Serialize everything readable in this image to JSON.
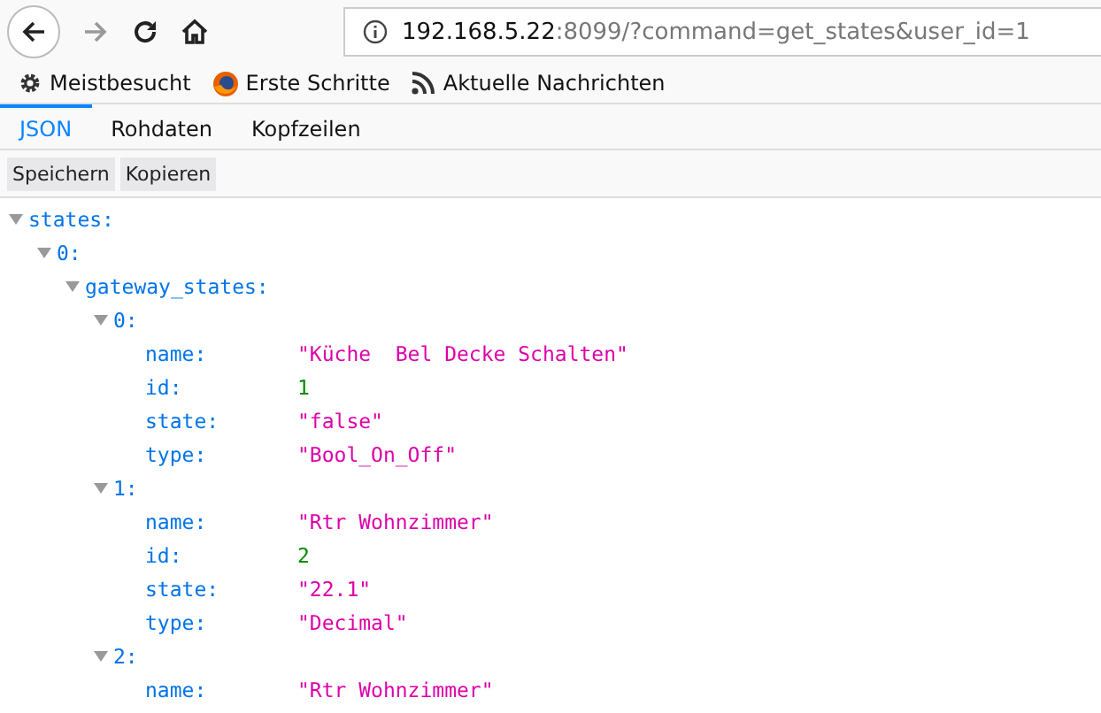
{
  "address_bar": {
    "host": "192.168.5.22",
    "rest": ":8099/?command=get_states&user_id=1"
  },
  "bookmarks": [
    {
      "label": "Meistbesucht",
      "kind": "gear"
    },
    {
      "label": "Erste Schritte",
      "kind": "firefox"
    },
    {
      "label": "Aktuelle Nachrichten",
      "kind": "rss"
    }
  ],
  "tabs": [
    {
      "label": "JSON",
      "selected": true
    },
    {
      "label": "Rohdaten",
      "selected": false
    },
    {
      "label": "Kopfzeilen",
      "selected": false
    }
  ],
  "buttons": [
    "Speichern",
    "Kopieren"
  ],
  "tree": [
    {
      "key": "states:",
      "expanded": true,
      "children": [
        {
          "key": "0:",
          "expanded": true,
          "children": [
            {
              "key": "gateway_states:",
              "expanded": true,
              "children": [
                {
                  "key": "0:",
                  "expanded": true,
                  "children": [
                    {
                      "key": "name:",
                      "value": "\"Küche  Bel Decke Schalten\"",
                      "kind": "string"
                    },
                    {
                      "key": "id:",
                      "value": "1",
                      "kind": "number"
                    },
                    {
                      "key": "state:",
                      "value": "\"false\"",
                      "kind": "string"
                    },
                    {
                      "key": "type:",
                      "value": "\"Bool_On_Off\"",
                      "kind": "string"
                    }
                  ]
                },
                {
                  "key": "1:",
                  "expanded": true,
                  "children": [
                    {
                      "key": "name:",
                      "value": "\"Rtr Wohnzimmer\"",
                      "kind": "string"
                    },
                    {
                      "key": "id:",
                      "value": "2",
                      "kind": "number"
                    },
                    {
                      "key": "state:",
                      "value": "\"22.1\"",
                      "kind": "string"
                    },
                    {
                      "key": "type:",
                      "value": "\"Decimal\"",
                      "kind": "string"
                    }
                  ]
                },
                {
                  "key": "2:",
                  "expanded": true,
                  "children": [
                    {
                      "key": "name:",
                      "value": "\"Rtr Wohnzimmer\"",
                      "kind": "string"
                    }
                  ]
                }
              ]
            }
          ]
        }
      ]
    }
  ]
}
